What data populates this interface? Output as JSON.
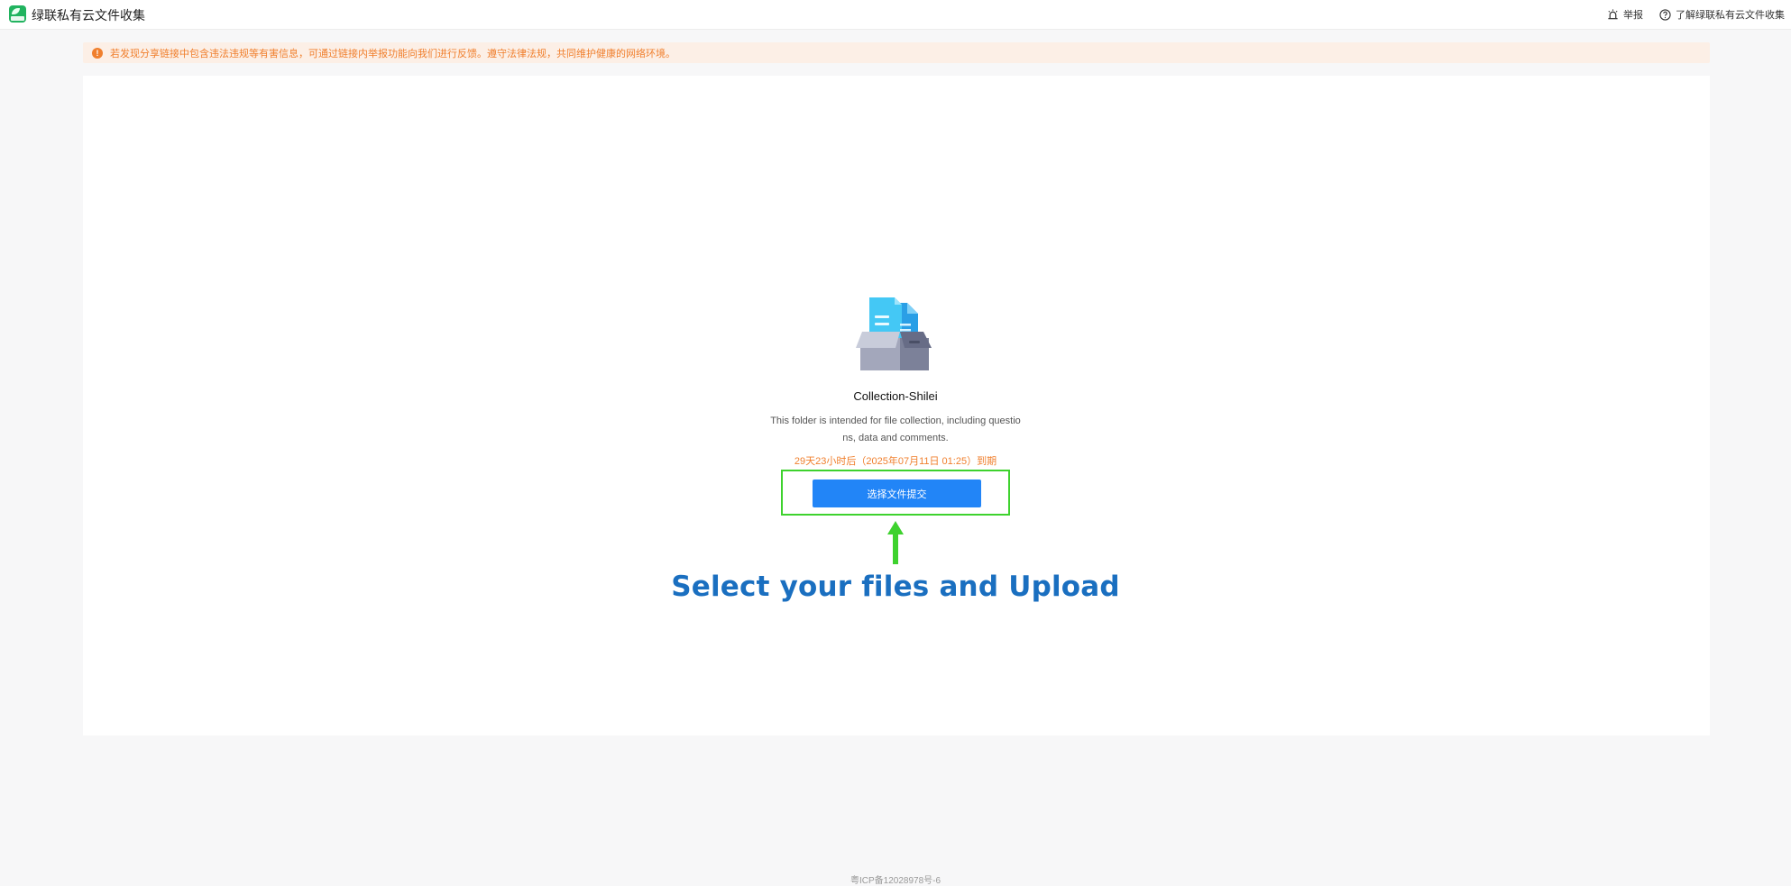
{
  "header": {
    "app_title": "绿联私有云文件收集",
    "report_label": "举报",
    "learn_more_label": "了解绿联私有云文件收集",
    "icons": {
      "logo": "ugreen-logo",
      "report": "alarm-icon",
      "help": "help-circle-icon"
    }
  },
  "notice": {
    "icon": "warning-icon",
    "text": "若发现分享链接中包含违法违规等有害信息，可通过链接内举报功能向我们进行反馈。遵守法律法规，共同维护健康的网络环境。",
    "color": "#f07f2d"
  },
  "collection": {
    "illustration": "file-box-icon",
    "title": "Collection-Shilei",
    "description": "This folder is intended for file collection, including questions, data and comments.",
    "expiry": "29天23小时后（2025年07月11日 01:25）到期",
    "submit_label": "选择文件提交"
  },
  "annotation": {
    "caption": "Select your files and Upload",
    "highlight_color": "#3ed22e",
    "arrow_icon": "arrow-up-icon"
  },
  "footer": {
    "icp": "粤ICP备12028978号-6"
  },
  "colors": {
    "primary": "#2285f7",
    "warning": "#f07f2d",
    "caption": "#1a6fc0"
  }
}
